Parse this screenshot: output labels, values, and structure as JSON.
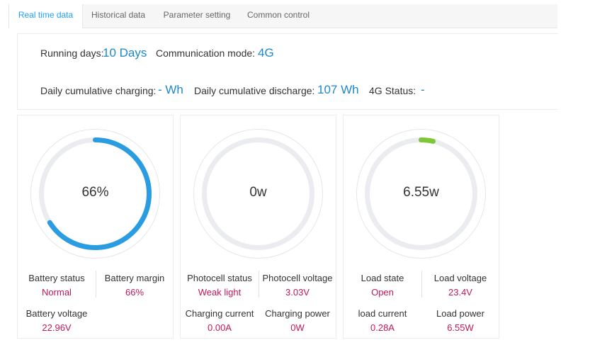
{
  "tabs": [
    {
      "label": "Real time data",
      "active": true
    },
    {
      "label": "Historical data",
      "active": false
    },
    {
      "label": "Parameter setting",
      "active": false
    },
    {
      "label": "Common control",
      "active": false
    }
  ],
  "summary": {
    "running_days_label": "Running days:",
    "running_days_value": "10 Days",
    "comm_mode_label": "Communication mode:",
    "comm_mode_value": "4G",
    "daily_charging_label": "Daily cumulative charging:",
    "daily_charging_value": "- Wh",
    "daily_discharge_label": "Daily cumulative discharge:",
    "daily_discharge_value": "107 Wh",
    "status_4g_label": "4G Status:",
    "status_4g_value": "-"
  },
  "colors": {
    "accent": "#1e9fff",
    "value_blue": "#1e88c8",
    "value_red": "#c2185b",
    "battery_arc": "#2a9de2",
    "load_arc": "#7ec738",
    "track": "#eaecef"
  },
  "cards": [
    {
      "gauge_text": "66%",
      "gauge_fraction": 0.66,
      "gauge_color": "#2a9de2",
      "fields": [
        {
          "label": "Battery status",
          "value": "Normal"
        },
        {
          "label": "Battery margin",
          "value": "66%"
        },
        {
          "label": "Battery voltage",
          "value": "22.96V"
        }
      ]
    },
    {
      "gauge_text": "0w",
      "gauge_fraction": 0,
      "gauge_color": "#2a9de2",
      "fields": [
        {
          "label": "Photocell status",
          "value": "Weak light"
        },
        {
          "label": "Photocell voltage",
          "value": "3.03V"
        },
        {
          "label": "Charging current",
          "value": "0.00A"
        },
        {
          "label": "Charging power",
          "value": "0W"
        }
      ]
    },
    {
      "gauge_text": "6.55w",
      "gauge_fraction": 0.036,
      "gauge_color": "#7ec738",
      "fields": [
        {
          "label": "Load state",
          "value": "Open"
        },
        {
          "label": "Load voltage",
          "value": "23.4V"
        },
        {
          "label": "load current",
          "value": "0.28A"
        },
        {
          "label": "Load power",
          "value": "6.55W"
        }
      ]
    }
  ]
}
